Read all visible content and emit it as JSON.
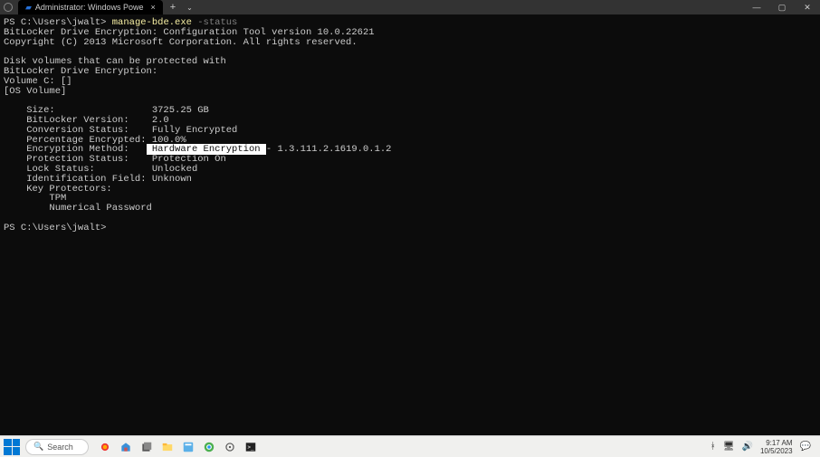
{
  "window": {
    "tab_title": "Administrator: Windows Powe",
    "close_glyph": "×",
    "new_tab_glyph": "+",
    "dropdown_glyph": "⌄",
    "minimize": "―",
    "maximize": "▢",
    "win_close": "✕"
  },
  "terminal": {
    "prompt1_prefix": "PS C:\\Users\\jwalt> ",
    "cmd": "manage-bde.exe",
    "cmd_arg": " -status",
    "line_tool": "BitLocker Drive Encryption: Configuration Tool version 10.0.22621",
    "line_copyright": "Copyright (C) 2013 Microsoft Corporation. All rights reserved.",
    "line_vol1": "Disk volumes that can be protected with",
    "line_vol2": "BitLocker Drive Encryption:",
    "line_volc": "Volume C: []",
    "line_os": "[OS Volume]",
    "field_size_label": "    Size:                ",
    "field_size_val": " 3725.25 GB",
    "field_blver_label": "    BitLocker Version:   ",
    "field_blver_val": " 2.0",
    "field_conv_label": "    Conversion Status:   ",
    "field_conv_val": " Fully Encrypted",
    "field_pct_label": "    Percentage Encrypted:",
    "field_pct_val": " 100.0%",
    "field_encm_label": "    Encryption Method:   ",
    "field_encm_highlight": " Hardware Encryption ",
    "field_encm_suffix": "- 1.3.111.2.1619.0.1.2",
    "field_prot_label": "    Protection Status:   ",
    "field_prot_val": " Protection On",
    "field_lock_label": "    Lock Status:         ",
    "field_lock_val": " Unlocked",
    "field_idf_label": "    Identification Field:",
    "field_idf_val": " Unknown",
    "field_kp_label": "    Key Protectors:",
    "kp_tpm": "        TPM",
    "kp_numpw": "        Numerical Password",
    "prompt2": "PS C:\\Users\\jwalt>"
  },
  "taskbar": {
    "search_placeholder": "Search",
    "time": "9:17 AM",
    "date": "10/5/2023"
  }
}
